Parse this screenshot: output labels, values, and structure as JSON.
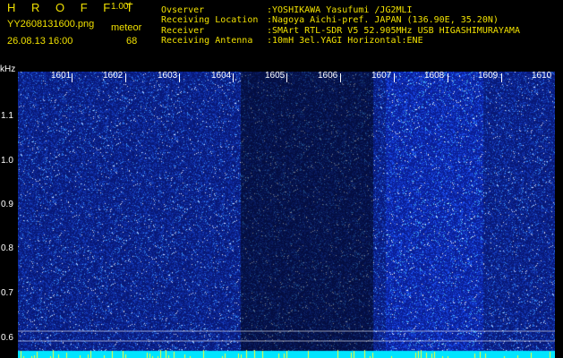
{
  "header": {
    "app_title": "H R O F F T",
    "version": "1.00f",
    "filename": "YY2608131600.png",
    "mode": "meteor",
    "datetime": "26.08.13 16:00",
    "count": "68"
  },
  "info": [
    {
      "label": "Ovserver",
      "value": ":YOSHIKAWA Yasufumi /JG2MLI"
    },
    {
      "label": "Receiving Location",
      "value": ":Nagoya Aichi-pref. JAPAN (136.90E, 35.20N)"
    },
    {
      "label": "Receiver",
      "value": ":SMArt RTL-SDR V5 52.905MHz USB HIGASHIMURAYAMA"
    },
    {
      "label": "Receiving Antenna",
      "value": ":10mH 3el.YAGI Horizontal:ENE"
    }
  ],
  "axis": {
    "unit": "kHz",
    "yticks": [
      "1.1",
      "1.0",
      "0.9",
      "0.8",
      "0.7",
      "0.6"
    ]
  },
  "timeline": [
    "1601",
    "1602",
    "1603",
    "1604",
    "1605",
    "1606",
    "1607",
    "1608",
    "1609",
    "1610"
  ],
  "colors": {
    "background": "#000000",
    "header_text": "#f0e000",
    "base_blue": "#0a1f8a",
    "quiet_band": "#07156a",
    "noise_floor": "#00e5ff",
    "spikes": "#ffff30"
  }
}
